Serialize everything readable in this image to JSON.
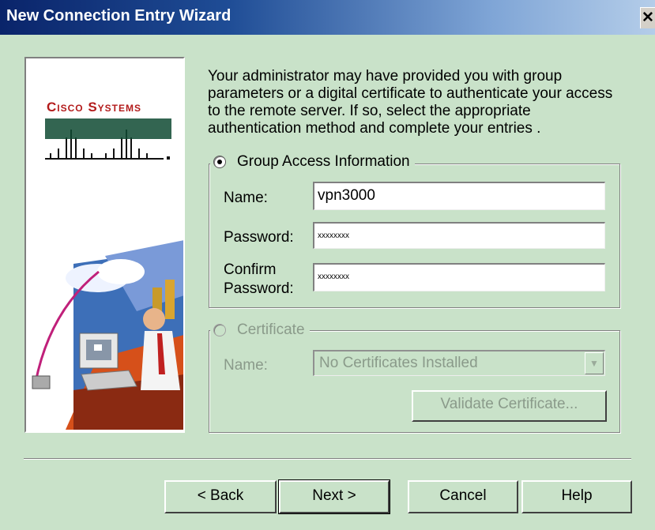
{
  "window": {
    "title": "New Connection Entry Wizard",
    "close_glyph": "✕"
  },
  "branding": {
    "logo_text": "Cisco Systems",
    "brand_color": "#b31b1b"
  },
  "intro_text": "Your administrator may have provided you with group parameters or a digital certificate to authenticate your access to the remote server.  If so, select the appropriate authentication method and complete your entries .",
  "group_access": {
    "label": "Group Access Information",
    "selected": true,
    "name_label": "Name:",
    "name_value": "vpn3000",
    "password_label": "Password:",
    "password_value": "xxxxxxxx",
    "confirm_label_line1": "Confirm",
    "confirm_label_line2": "Password:",
    "confirm_value": "xxxxxxxx"
  },
  "certificate": {
    "label": "Certificate",
    "selected": false,
    "name_label": "Name:",
    "select_value": "No Certificates Installed",
    "validate_label": "Validate Certificate..."
  },
  "buttons": {
    "back": "< Back",
    "next": "Next >",
    "cancel": "Cancel",
    "help": "Help"
  }
}
